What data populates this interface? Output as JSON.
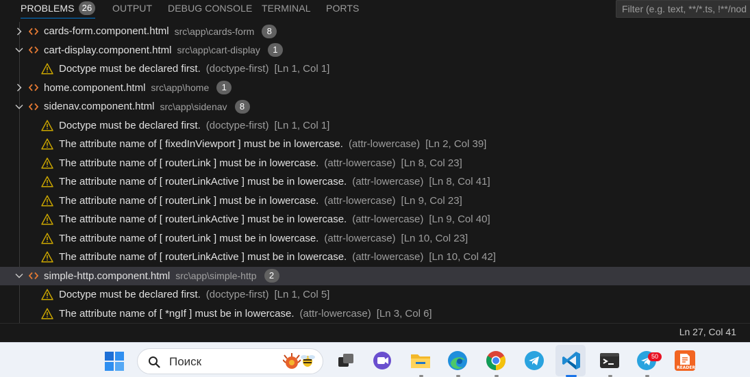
{
  "panel": {
    "tabs": [
      {
        "label": "PROBLEMS",
        "badge": "26",
        "active": true
      },
      {
        "label": "OUTPUT"
      },
      {
        "label": "DEBUG CONSOLE"
      },
      {
        "label": "TERMINAL"
      },
      {
        "label": "PORTS"
      }
    ],
    "filter_placeholder": "Filter (e.g. text, **/*.ts, !**/node_modules/**)"
  },
  "problems": {
    "files": [
      {
        "name": "cards-form.component.html",
        "path": "src\\app\\cards-form",
        "count": "8",
        "expanded": false,
        "items": []
      },
      {
        "name": "cart-display.component.html",
        "path": "src\\app\\cart-display",
        "count": "1",
        "expanded": true,
        "items": [
          {
            "message": "Doctype must be declared first.",
            "source": "(doctype-first)",
            "location": "[Ln 1, Col 1]"
          }
        ]
      },
      {
        "name": "home.component.html",
        "path": "src\\app\\home",
        "count": "1",
        "expanded": false,
        "items": []
      },
      {
        "name": "sidenav.component.html",
        "path": "src\\app\\sidenav",
        "count": "8",
        "expanded": true,
        "items": [
          {
            "message": "Doctype must be declared first.",
            "source": "(doctype-first)",
            "location": "[Ln 1, Col 1]"
          },
          {
            "message": "The attribute name of [ fixedInViewport ] must be in lowercase.",
            "source": "(attr-lowercase)",
            "location": "[Ln 2, Col 39]"
          },
          {
            "message": "The attribute name of [ routerLink ] must be in lowercase.",
            "source": "(attr-lowercase)",
            "location": "[Ln 8, Col 23]"
          },
          {
            "message": "The attribute name of [ routerLinkActive ] must be in lowercase.",
            "source": "(attr-lowercase)",
            "location": "[Ln 8, Col 41]"
          },
          {
            "message": "The attribute name of [ routerLink ] must be in lowercase.",
            "source": "(attr-lowercase)",
            "location": "[Ln 9, Col 23]"
          },
          {
            "message": "The attribute name of [ routerLinkActive ] must be in lowercase.",
            "source": "(attr-lowercase)",
            "location": "[Ln 9, Col 40]"
          },
          {
            "message": "The attribute name of [ routerLink ] must be in lowercase.",
            "source": "(attr-lowercase)",
            "location": "[Ln 10, Col 23]"
          },
          {
            "message": "The attribute name of [ routerLinkActive ] must be in lowercase.",
            "source": "(attr-lowercase)",
            "location": "[Ln 10, Col 42]"
          }
        ]
      },
      {
        "name": "simple-http.component.html",
        "path": "src\\app\\simple-http",
        "count": "2",
        "expanded": true,
        "selected": true,
        "items": [
          {
            "message": "Doctype must be declared first.",
            "source": "(doctype-first)",
            "location": "[Ln 1, Col 5]"
          },
          {
            "message": "The attribute name of [ *ngIf ] must be in lowercase.",
            "source": "(attr-lowercase)",
            "location": "[Ln 3, Col 6]"
          }
        ]
      }
    ]
  },
  "statusbar": {
    "cursor_position": "Ln 27, Col 41"
  },
  "taskbar": {
    "search_placeholder": "Поиск",
    "apps": [
      "start-icon",
      "task-view-icon",
      "meet-icon",
      "file-explorer-icon",
      "edge-icon",
      "chrome-icon",
      "telegram-icon",
      "vscode-icon",
      "terminal-icon",
      "telegram-beta-icon",
      "reader-icon"
    ],
    "notification_badge": "50",
    "reader_label": "READER"
  },
  "colors": {
    "panel_bg": "#181818",
    "accent": "#0078d4",
    "warning": "#cca700",
    "html_file": "#e37933",
    "badge_bg": "#616161",
    "selected_row": "#37373d"
  }
}
